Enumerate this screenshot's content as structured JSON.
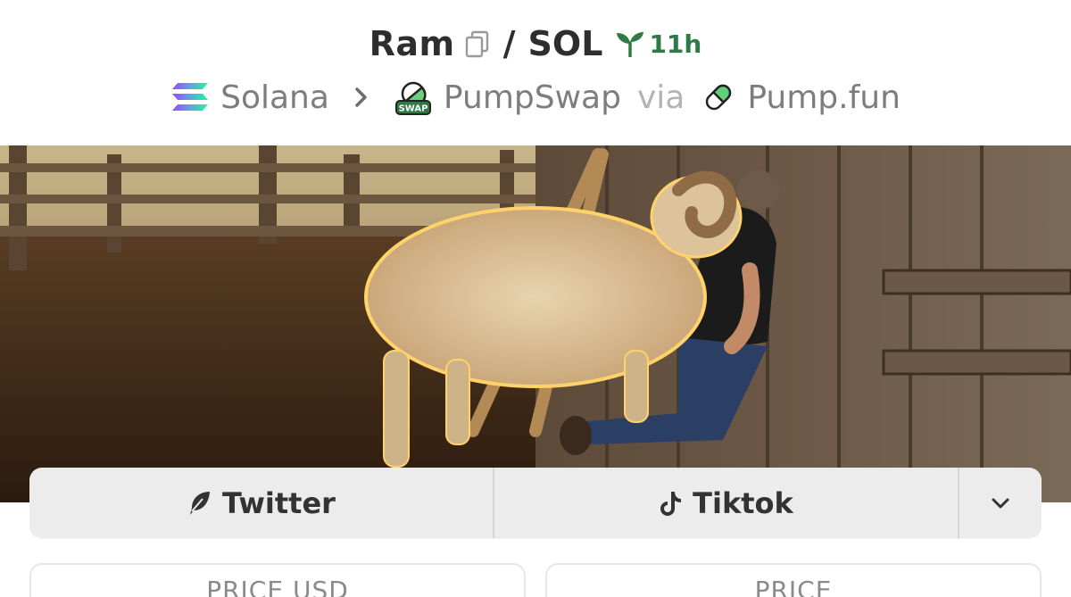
{
  "header": {
    "token_name": "Ram",
    "separator": "/",
    "quote_symbol": "SOL",
    "age": "11h",
    "age_color": "#2f7a44",
    "icons": [
      "copy-icon",
      "sprout-icon"
    ]
  },
  "meta": {
    "chain": "Solana",
    "dex": "PumpSwap",
    "via": "via",
    "launchpad": "Pump.fun",
    "icons": [
      "solana-logo-icon",
      "chevron-right-icon",
      "pumpswap-logo-icon",
      "pumpfun-pill-icon"
    ]
  },
  "banner": {
    "subject": "token-banner-image"
  },
  "links": [
    {
      "label": "Twitter",
      "icon": "feather-icon"
    },
    {
      "label": "Tiktok",
      "icon": "tiktok-icon"
    }
  ],
  "stats": {
    "price_usd_label": "PRICE USD",
    "price_label": "PRICE"
  },
  "colors": {
    "accent_green": "#2f7a44",
    "bar_bg": "#ececec"
  }
}
